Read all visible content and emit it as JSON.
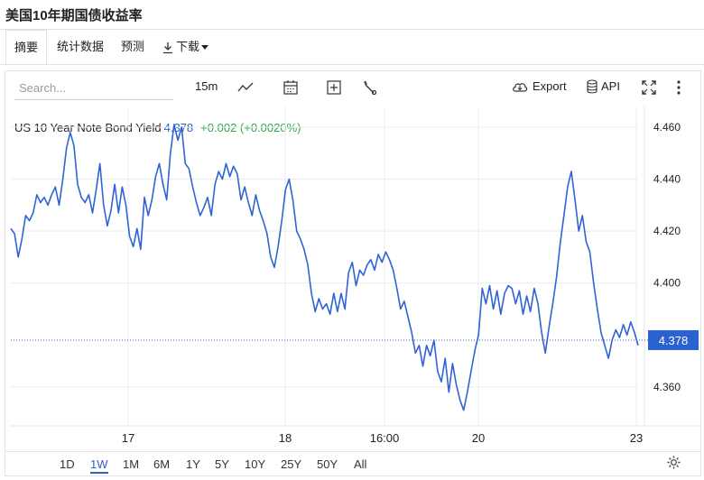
{
  "page": {
    "title": "美国10年期国债收益率"
  },
  "tabs": [
    {
      "label": "摘要",
      "active": true
    },
    {
      "label": "统计数据",
      "active": false
    },
    {
      "label": "预测",
      "active": false
    },
    {
      "label": "下载",
      "active": false
    }
  ],
  "toolbar": {
    "search_placeholder": "Search...",
    "interval": "15m",
    "export_label": "Export",
    "api_label": "API",
    "icons": [
      "line-chart-icon",
      "calendar-icon",
      "add-indicator-icon",
      "wrench-icon",
      "cloud-download-icon",
      "database-icon",
      "fullscreen-icon",
      "more-vertical-icon",
      "settings-gear-icon"
    ]
  },
  "legend": {
    "name": "US 10 Year Note Bond Yield",
    "value": "4.378",
    "change": "+0.002 (+0.0020%)"
  },
  "colors": {
    "line": "#2f63d6",
    "price_tag": "#2a62d0",
    "change_up": "#28a84a",
    "grid": "#ececec"
  },
  "time_ranges": [
    {
      "label": "1D",
      "active": false
    },
    {
      "label": "1W",
      "active": true
    },
    {
      "label": "1M",
      "active": false
    },
    {
      "label": "6M",
      "active": false
    },
    {
      "label": "1Y",
      "active": false
    },
    {
      "label": "5Y",
      "active": false
    },
    {
      "label": "10Y",
      "active": false
    },
    {
      "label": "25Y",
      "active": false
    },
    {
      "label": "50Y",
      "active": false
    },
    {
      "label": "All",
      "active": false
    }
  ],
  "chart_data": {
    "type": "line",
    "ylim": [
      4.345,
      4.468
    ],
    "y_ticks": [
      "4.460",
      "4.440",
      "4.420",
      "4.400",
      "4.360"
    ],
    "x_ticks": [
      "17",
      "18",
      "16:00",
      "20",
      "23"
    ],
    "last_value": "4.378",
    "series": [
      {
        "values": [
          4.421,
          4.419,
          4.41,
          4.417,
          4.426,
          4.424,
          4.427,
          4.434,
          4.431,
          4.433,
          4.43,
          4.434,
          4.437,
          4.43,
          4.44,
          4.452,
          4.458,
          4.453,
          4.438,
          4.433,
          4.431,
          4.434,
          4.427,
          4.436,
          4.446,
          4.43,
          4.422,
          4.428,
          4.438,
          4.427,
          4.437,
          4.43,
          4.418,
          4.414,
          4.421,
          4.413,
          4.433,
          4.426,
          4.432,
          4.441,
          4.446,
          4.438,
          4.432,
          4.45,
          4.461,
          4.455,
          4.46,
          4.446,
          4.444,
          4.437,
          4.431,
          4.426,
          4.429,
          4.433,
          4.426,
          4.438,
          4.443,
          4.44,
          4.446,
          4.441,
          4.445,
          4.442,
          4.432,
          4.437,
          4.431,
          4.426,
          4.434,
          4.428,
          4.424,
          4.419,
          4.41,
          4.406,
          4.414,
          4.424,
          4.436,
          4.44,
          4.432,
          4.42,
          4.417,
          4.413,
          4.407,
          4.396,
          4.389,
          4.394,
          4.39,
          4.392,
          4.388,
          4.396,
          4.389,
          4.396,
          4.39,
          4.404,
          4.408,
          4.399,
          4.405,
          4.403,
          4.407,
          4.409,
          4.405,
          4.411,
          4.408,
          4.412,
          4.409,
          4.405,
          4.398,
          4.39,
          4.393,
          4.387,
          4.381,
          4.373,
          4.376,
          4.368,
          4.376,
          4.372,
          4.378,
          4.366,
          4.362,
          4.371,
          4.358,
          4.369,
          4.361,
          4.355,
          4.351,
          4.358,
          4.366,
          4.374,
          4.38,
          4.398,
          4.392,
          4.399,
          4.39,
          4.397,
          4.388,
          4.396,
          4.399,
          4.398,
          4.392,
          4.397,
          4.388,
          4.395,
          4.389,
          4.398,
          4.392,
          4.381,
          4.373,
          4.383,
          4.392,
          4.402,
          4.415,
          4.426,
          4.437,
          4.443,
          4.432,
          4.42,
          4.426,
          4.416,
          4.412,
          4.4,
          4.39,
          4.381,
          4.376,
          4.371,
          4.378,
          4.382,
          4.379,
          4.384,
          4.38,
          4.385,
          4.381,
          4.376
        ]
      }
    ]
  }
}
